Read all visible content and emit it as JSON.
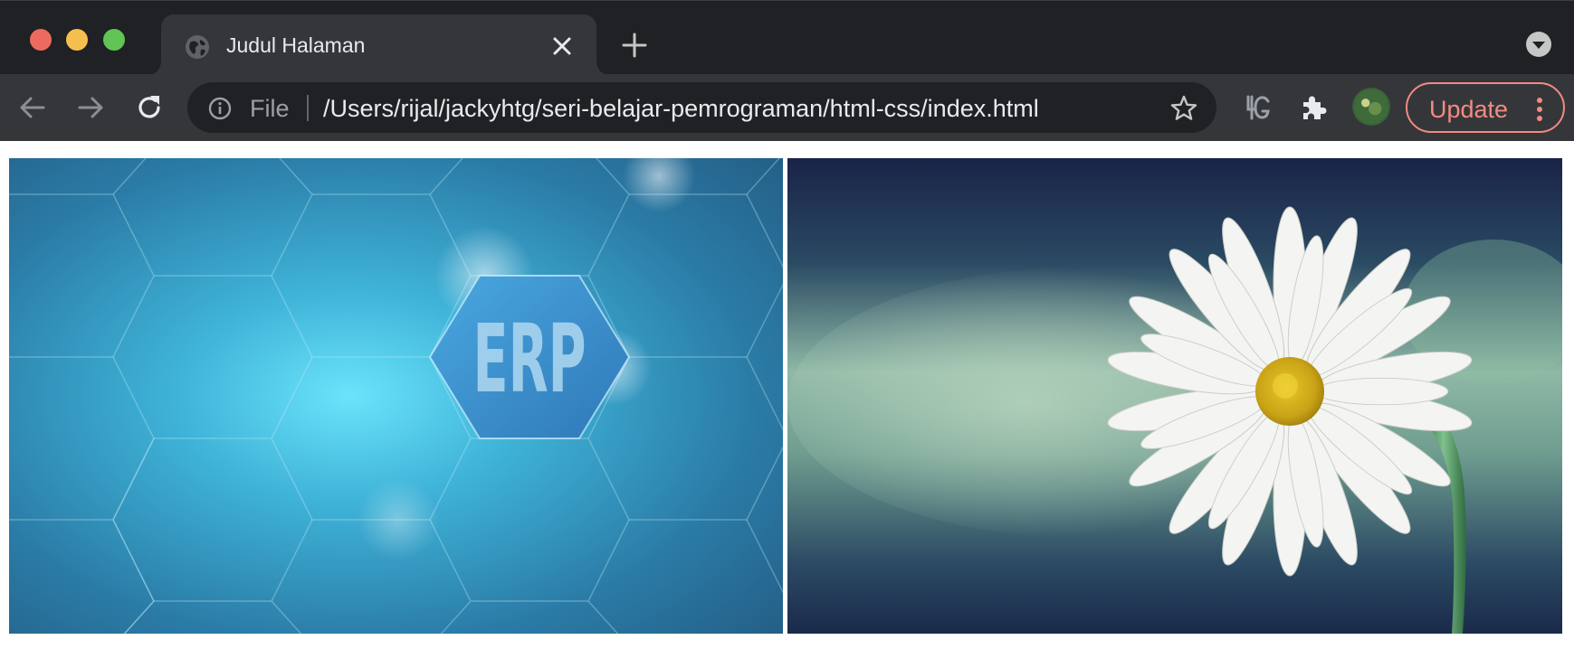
{
  "window": {
    "controls": [
      "close",
      "minimize",
      "zoom"
    ]
  },
  "tab": {
    "title": "Judul Halaman",
    "favicon": "globe-icon",
    "close_icon": "close-icon"
  },
  "tabstrip": {
    "new_tab_icon": "plus-icon",
    "tab_search_icon": "chevron-down-icon"
  },
  "toolbar": {
    "back_icon": "back-arrow-icon",
    "forward_icon": "forward-arrow-icon",
    "reload_icon": "reload-icon",
    "omnibox": {
      "info_icon": "info-icon",
      "scheme_label": "File",
      "url": "/Users/rijal/jackyhtg/seri-belajar-pemrograman/html-css/index.html",
      "bookmark_icon": "star-icon"
    },
    "extensions": [
      "g-extension-icon",
      "puzzle-icon"
    ],
    "avatar": "profile-avatar",
    "update_label": "Update",
    "menu_icon": "kebab-menu-icon"
  },
  "page": {
    "images": [
      {
        "name": "erp-image",
        "text": "ERP"
      },
      {
        "name": "daisy-image"
      }
    ]
  },
  "colors": {
    "tabstrip_bg": "#202124",
    "toolbar_bg": "#35363a",
    "omnibox_bg": "#202124",
    "update_accent": "#f28b82"
  }
}
